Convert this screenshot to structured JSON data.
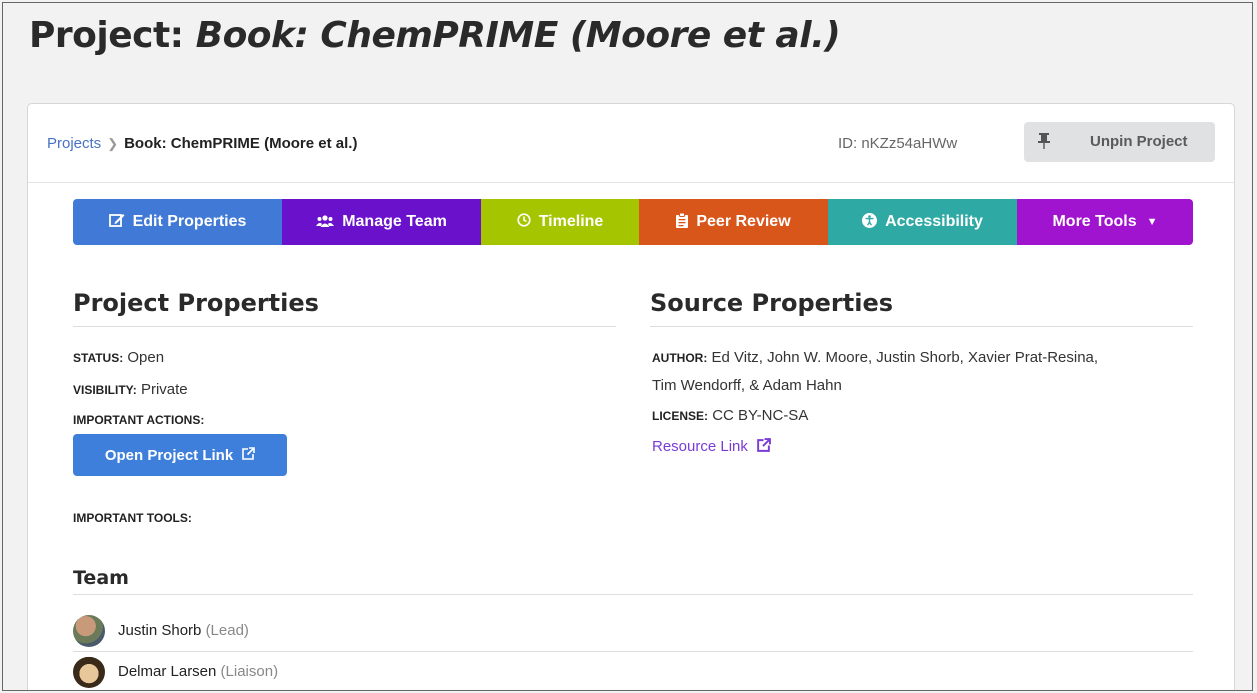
{
  "page": {
    "title_prefix": "Project:",
    "title_name": "Book: ChemPRIME (Moore et al.)"
  },
  "header": {
    "breadcrumb_root": "Projects",
    "breadcrumb_current": "Book: ChemPRIME (Moore et al.)",
    "project_id": "ID: nKZz54aHWw",
    "unpin_label": "Unpin Project"
  },
  "toolbar": {
    "buttons": [
      {
        "label": "Edit Properties",
        "icon": "edit-icon",
        "color": "#4179d6"
      },
      {
        "label": "Manage Team",
        "icon": "users-icon",
        "color": "#6a11cb"
      },
      {
        "label": "Timeline",
        "icon": "clock-icon",
        "color": "#a5c500"
      },
      {
        "label": "Peer Review",
        "icon": "clipboard-icon",
        "color": "#d9561b"
      },
      {
        "label": "Accessibility",
        "icon": "accessibility-icon",
        "color": "#2fa9a4"
      },
      {
        "label": "More Tools",
        "icon": "caret-down-icon",
        "color": "#a014cf"
      }
    ]
  },
  "project_properties": {
    "heading": "Project Properties",
    "status_key": "STATUS:",
    "status_value": "Open",
    "visibility_key": "VISIBILITY:",
    "visibility_value": "Private",
    "actions_key": "IMPORTANT ACTIONS:",
    "open_link_label": "Open Project Link",
    "tools_key": "IMPORTANT TOOLS:"
  },
  "source_properties": {
    "heading": "Source Properties",
    "author_key": "AUTHOR:",
    "author_line1": "Ed Vitz, John W. Moore, Justin Shorb, Xavier Prat-Resina,",
    "author_line2": "Tim Wendorff, & Adam Hahn",
    "license_key": "LICENSE:",
    "license_value": "CC BY-NC-SA",
    "resource_link_label": "Resource Link"
  },
  "team": {
    "heading": "Team",
    "members": [
      {
        "name": "Justin Shorb",
        "role": "(Lead)"
      },
      {
        "name": "Delmar Larsen",
        "role": "(Liaison)"
      }
    ]
  },
  "colors": {
    "link": "#4a72c4",
    "resource_link": "#7a3bd6",
    "primary_button": "#3f7fdc"
  }
}
